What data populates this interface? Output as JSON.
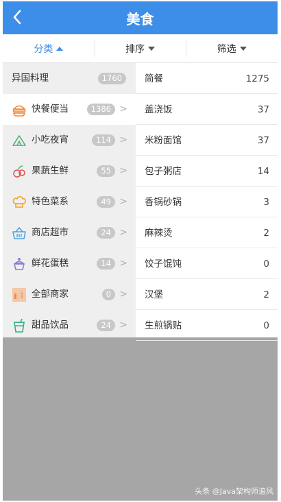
{
  "header": {
    "title": "美食",
    "back_icon": "chevron-left-icon",
    "bg": "#3d8ee8"
  },
  "filter_tabs": [
    {
      "label": "分类",
      "active": true,
      "caret": "up"
    },
    {
      "label": "排序",
      "active": false,
      "caret": "down"
    },
    {
      "label": "筛选",
      "active": false,
      "caret": "down"
    }
  ],
  "categories": [
    {
      "label": "异国料理",
      "count": "1760",
      "icon": "",
      "selected": false
    },
    {
      "label": "快餐便当",
      "count": "1386",
      "icon": "burger-icon",
      "selected": true
    },
    {
      "label": "小吃夜宵",
      "count": "114",
      "icon": "tent-icon",
      "selected": false
    },
    {
      "label": "果蔬生鲜",
      "count": "55",
      "icon": "fruit-icon",
      "selected": false
    },
    {
      "label": "特色菜系",
      "count": "49",
      "icon": "chef-hat-icon",
      "selected": false
    },
    {
      "label": "商店超市",
      "count": "24",
      "icon": "basket-icon",
      "selected": false
    },
    {
      "label": "鲜花蛋糕",
      "count": "14",
      "icon": "cake-icon",
      "selected": false
    },
    {
      "label": "全部商家",
      "count": "0",
      "icon": "store-icon",
      "selected": false
    },
    {
      "label": "甜品饮品",
      "count": "24",
      "icon": "drink-icon",
      "selected": false
    }
  ],
  "subcategories": [
    {
      "label": "简餐",
      "count": "1275"
    },
    {
      "label": "盖浇饭",
      "count": "37"
    },
    {
      "label": "米粉面馆",
      "count": "37"
    },
    {
      "label": "包子粥店",
      "count": "14"
    },
    {
      "label": "香锅砂锅",
      "count": "3"
    },
    {
      "label": "麻辣烫",
      "count": "2"
    },
    {
      "label": "饺子馄饨",
      "count": "0"
    },
    {
      "label": "汉堡",
      "count": "2"
    },
    {
      "label": "生煎锅贴",
      "count": "0"
    }
  ],
  "chevron": ">",
  "watermark": "头条 @Java架构师追风"
}
